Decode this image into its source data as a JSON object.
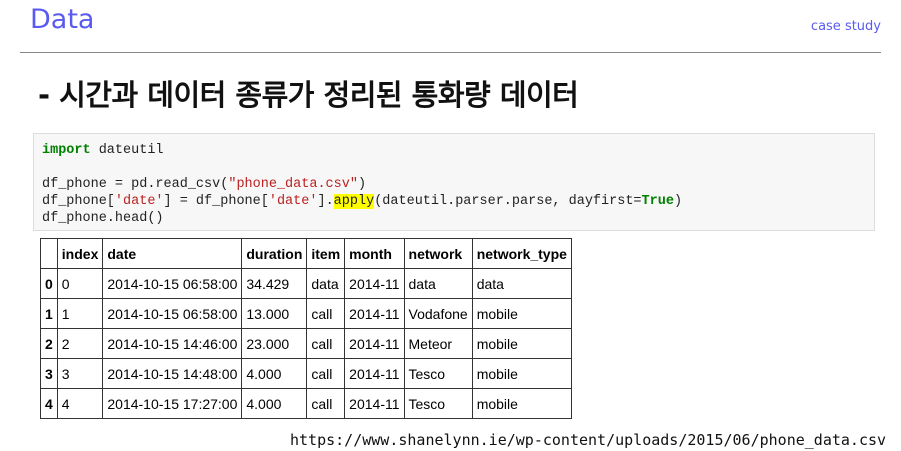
{
  "header": {
    "title": "Data",
    "section": "case study"
  },
  "heading": "-  시간과 데이터 종류가 정리된 통화량 데이터",
  "code": {
    "l1_kw": "import",
    "l1_rest": " dateutil",
    "l2a": "df_phone = pd.read_csv(",
    "l2s": "\"phone_data.csv\"",
    "l2b": ")",
    "l3a": "df_phone[",
    "l3s1": "'date'",
    "l3b": "] = df_phone[",
    "l3s2": "'date'",
    "l3c": "].",
    "l3hl": "apply",
    "l3d": "(dateutil.parser.parse, dayfirst=",
    "l3kw": "True",
    "l3e": ")",
    "l4": "df_phone.head()"
  },
  "table": {
    "columns": [
      "",
      "index",
      "date",
      "duration",
      "item",
      "month",
      "network",
      "network_type"
    ],
    "rows": [
      [
        "0",
        "0",
        "2014-10-15 06:58:00",
        "34.429",
        "data",
        "2014-11",
        "data",
        "data"
      ],
      [
        "1",
        "1",
        "2014-10-15 06:58:00",
        "13.000",
        "call",
        "2014-11",
        "Vodafone",
        "mobile"
      ],
      [
        "2",
        "2",
        "2014-10-15 14:46:00",
        "23.000",
        "call",
        "2014-11",
        "Meteor",
        "mobile"
      ],
      [
        "3",
        "3",
        "2014-10-15 14:48:00",
        "4.000",
        "call",
        "2014-11",
        "Tesco",
        "mobile"
      ],
      [
        "4",
        "4",
        "2014-10-15 17:27:00",
        "4.000",
        "call",
        "2014-11",
        "Tesco",
        "mobile"
      ]
    ]
  },
  "source_url": "https://www.shanelynn.ie/wp-content/uploads/2015/06/phone_data.csv"
}
